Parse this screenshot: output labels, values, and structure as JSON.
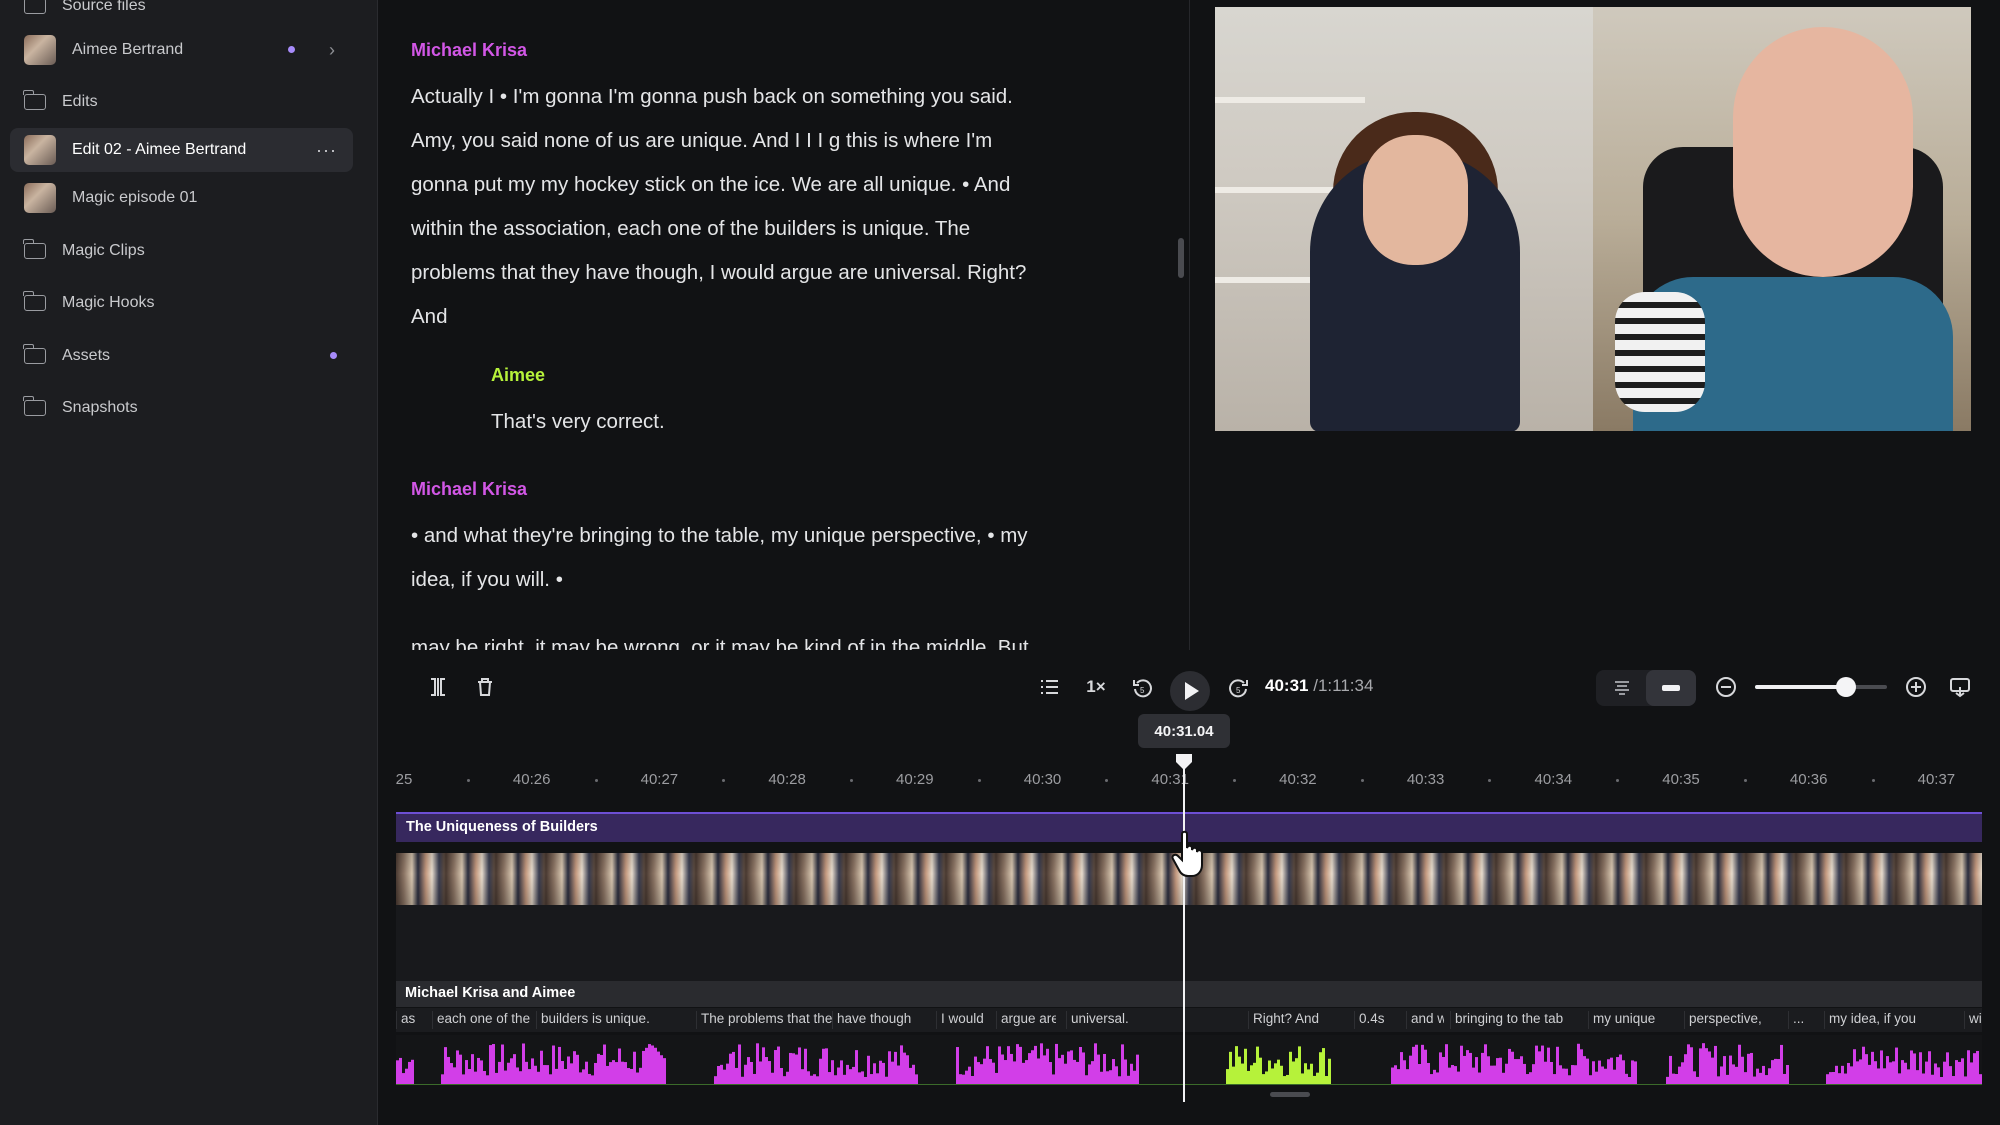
{
  "sidebar": {
    "items": [
      {
        "label": "Source files",
        "type": "folder"
      },
      {
        "label": "Aimee Bertrand",
        "type": "media"
      },
      {
        "label": "Edits",
        "type": "folder"
      },
      {
        "label": "Edit 02 - Aimee Bertrand",
        "type": "media",
        "active": true
      },
      {
        "label": "Magic episode 01",
        "type": "media"
      },
      {
        "label": "Magic Clips",
        "type": "folder"
      },
      {
        "label": "Magic Hooks",
        "type": "folder"
      },
      {
        "label": "Assets",
        "type": "folder"
      },
      {
        "label": "Snapshots",
        "type": "folder"
      }
    ],
    "more_label": "···",
    "chevron": "›"
  },
  "transcript": {
    "blocks": [
      {
        "speaker": "Michael Krisa",
        "lines": [
          "Actually I • I'm gonna I'm gonna push back on something you said.",
          "Amy, you said none of us are unique. And I I I g this is where I'm",
          "gonna put my my hockey stick on the ice. We are all unique. • And",
          "within the association, each one of the builders is unique. The",
          "problems that they have though, I would argue are universal. Right?",
          "And"
        ]
      },
      {
        "speaker": "Aimee",
        "lines": [
          "That's very correct."
        ]
      },
      {
        "speaker": "Michael Krisa",
        "lines": [
          "• and what they're bringing to the table, my unique perspective, • my",
          "idea, if you will. •",
          "may be right, it may be wrong, or it may be kind of in the middle. But"
        ]
      }
    ]
  },
  "player": {
    "speed_label": "1×",
    "current_time": "40:31",
    "total_time": "/1:11:34",
    "playhead_tooltip": "40:31.04",
    "zoom_level": 0.69
  },
  "timeline": {
    "ruler_labels": [
      "25",
      "40:26",
      "40:27",
      "40:28",
      "40:29",
      "40:30",
      "40:31",
      "40:32",
      "40:33",
      "40:34",
      "40:35",
      "40:36",
      "40:37"
    ],
    "chapter_title": "The Uniqueness of Builders",
    "audio_track_title": "Michael Krisa and Aimee",
    "words": [
      "as",
      "each one of the",
      "builders is unique.",
      "The problems that the",
      "have though",
      "I would",
      "argue are",
      "universal.",
      "Right? And",
      "0.4s",
      "and what",
      "bringing to the tab",
      "my unique",
      "perspective,",
      "...",
      "my idea, if you",
      "will"
    ]
  },
  "colors": {
    "speaker_michael": "#d257e6",
    "speaker_aimee": "#b6f23a",
    "chapter_bar": "#37285e",
    "waveform_michael": "#d23ee8",
    "waveform_aimee": "#b6f23a"
  },
  "icons": {
    "split": "split-icon",
    "delete": "trash-icon",
    "list": "list-icon",
    "rewind": "rewind-5-icon",
    "play": "play-icon",
    "forward": "forward-5-icon",
    "zoom_out": "zoom-out-icon",
    "zoom_in": "zoom-in-icon",
    "export": "export-icon"
  }
}
